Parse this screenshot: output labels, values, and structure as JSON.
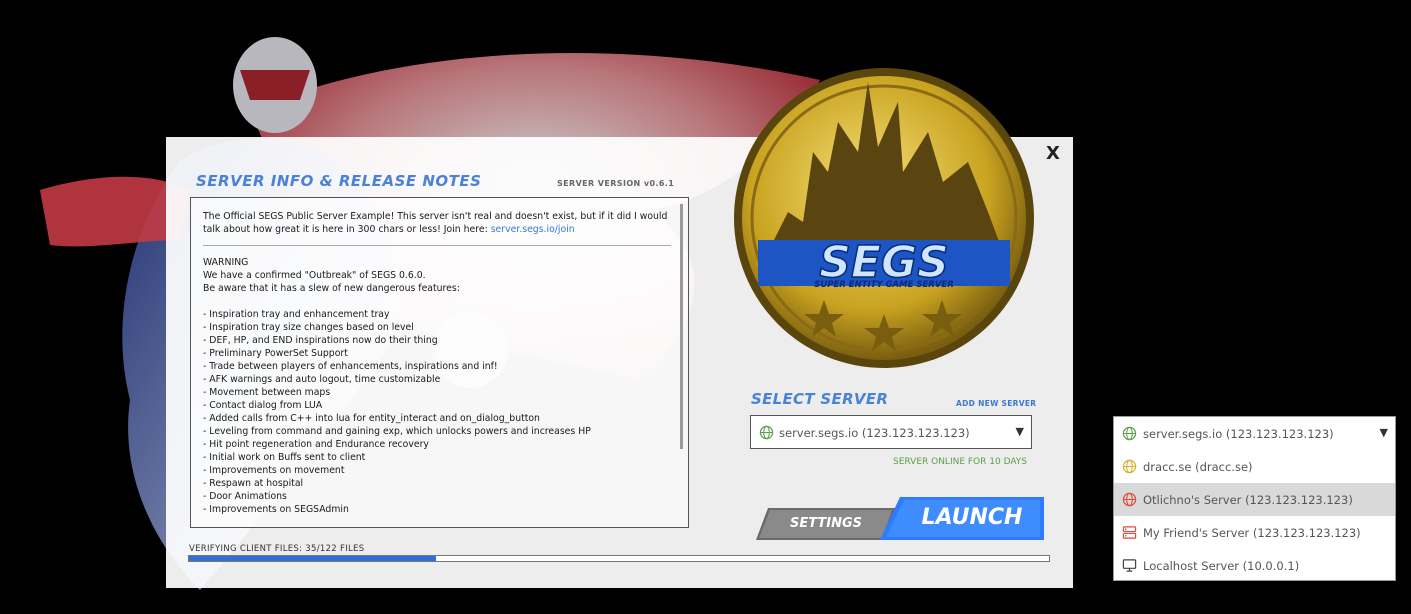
{
  "window": {
    "close_label": "X"
  },
  "notes": {
    "title": "SERVER INFO & RELEASE NOTES",
    "server_version": "SERVER VERSION v0.6.1",
    "intro": "The Official SEGS Public Server Example! This server isn't real and doesn't exist, but if it did I would",
    "intro2": "talk about how great it is here in 300 chars or less! Join here:",
    "join_link": "server.segs.io/join",
    "warning": "WARNING",
    "line1": "We have a confirmed \"Outbreak\" of SEGS 0.6.0.",
    "line2": "Be aware that it has a slew of new dangerous features:",
    "features": [
      "- Inspiration tray and enhancement tray",
      "- Inspiration tray size changes based on level",
      "- DEF, HP, and END inspirations now do their thing",
      "- Preliminary PowerSet Support",
      "- Trade between players of enhancements, inspirations and inf!",
      "- AFK warnings and auto logout, time customizable",
      "- Movement between maps",
      "- Contact dialog from LUA",
      "- Added calls from C++ into lua for entity_interact and on_dialog_button",
      "- Leveling from command and gaining exp, which unlocks powers and increases HP",
      "- Hit point regeneration and Endurance recovery",
      "- Initial work on Buffs sent to client",
      "- Improvements on movement",
      "- Respawn at hospital",
      "- Door Animations",
      "- Improvements on SEGSAdmin"
    ]
  },
  "logo": {
    "name": "SEGS",
    "tagline": "SUPER ENTITY GAME SERVER"
  },
  "server_select": {
    "title": "SELECT SERVER",
    "add_new": "ADD NEW SERVER",
    "selected": "server.segs.io  (123.123.123.123)",
    "status": "SERVER ONLINE FOR 10 DAYS",
    "arrow": "▼"
  },
  "buttons": {
    "settings": "SETTINGS",
    "launch": "LAUNCH"
  },
  "progress": {
    "label": "VERIFYING CLIENT FILES: 35/122 FILES",
    "fraction": 0.2869
  },
  "dropdown": {
    "items": [
      {
        "label": "server.segs.io  (123.123.123.123)",
        "icon": "globe-icon",
        "color": "#5aa04a"
      },
      {
        "label": "dracc.se  (dracc.se)",
        "icon": "globe-icon",
        "color": "#d4b02a"
      },
      {
        "label": "Otlichno's Server  (123.123.123.123)",
        "icon": "globe-icon",
        "color": "#e04a3a"
      },
      {
        "label": "My Friend's Server  (123.123.123.123)",
        "icon": "server-icon",
        "color": "#e04a3a"
      },
      {
        "label": "Localhost Server  (10.0.0.1)",
        "icon": "monitor-icon",
        "color": "#444444"
      }
    ],
    "arrow": "▼"
  }
}
